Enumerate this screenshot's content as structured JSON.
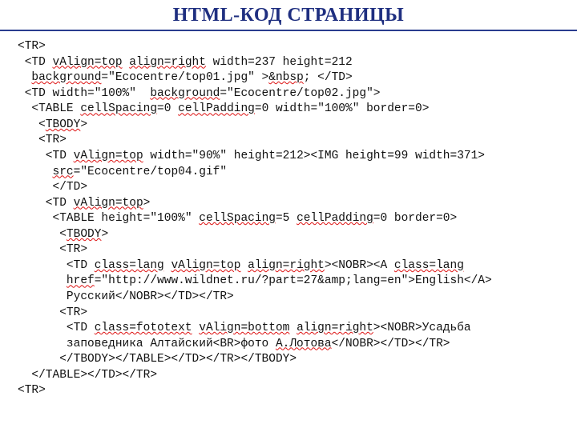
{
  "title": "HTML-КОД СТРАНИЦЫ",
  "code": {
    "l01a": "<TR>",
    "l02a": " <TD ",
    "l02b": "vAlign=top",
    "l02c": " ",
    "l02d": "align=right",
    "l02e": " width=237 height=212",
    "l03a": "  ",
    "l03b": "background",
    "l03c": "=\"Ecocentre/top01.jpg\" >",
    "l03d": "&nbsp",
    "l03e": "; </TD>",
    "l04a": " <TD width=\"100%\"  ",
    "l04b": "background",
    "l04c": "=\"Ecocentre/top02.jpg\">",
    "l05a": "  <TABLE ",
    "l05b": "cellSpacing",
    "l05c": "=0 ",
    "l05d": "cellPadding",
    "l05e": "=0 width=\"100%\" border=0>",
    "l06a": "   <",
    "l06b": "TBODY",
    "l06c": ">",
    "l07a": "   <TR>",
    "l08a": "    <TD ",
    "l08b": "vAlign=top",
    "l08c": " width=\"90%\" height=212><IMG height=99 width=371>",
    "l09a": "     ",
    "l09b": "src",
    "l09c": "=\"Ecocentre/top04.gif\"",
    "l10a": "     </TD>",
    "l11a": "    <TD ",
    "l11b": "vAlign=top",
    "l11c": ">",
    "l12a": "     <TABLE height=\"100%\" ",
    "l12b": "cellSpacing",
    "l12c": "=5 ",
    "l12d": "cellPadding",
    "l12e": "=0 border=0>",
    "l13a": "      <",
    "l13b": "TBODY",
    "l13c": ">",
    "l14a": "      <TR>",
    "l15a": "       <TD ",
    "l15b": "class=lang",
    "l15c": " ",
    "l15d": "vAlign=top",
    "l15e": " ",
    "l15f": "align=right",
    "l15g": "><NOBR><A ",
    "l15h": "class=lang",
    "l16a": "       ",
    "l16b": "href",
    "l16c": "=\"http://www.wildnet.ru/?part=27&amp;lang=en\">English</A>",
    "l17a": "       Русский</NOBR></TD></TR>",
    "l18a": "      <TR>",
    "l19a": "       <TD ",
    "l19b": "class=fototext",
    "l19c": " ",
    "l19d": "vAlign=bottom",
    "l19e": " ",
    "l19f": "align=right",
    "l19g": "><NOBR>Усадьба",
    "l20a": "       заповедника Алтайский<BR>фото ",
    "l20b": "А.Лотова",
    "l20c": "</NOBR></TD></TR>",
    "l21a": "      </TBODY></TABLE></TD></TR></TBODY>",
    "l22a": "  </TABLE></TD></TR>",
    "l23a": "<TR>"
  }
}
